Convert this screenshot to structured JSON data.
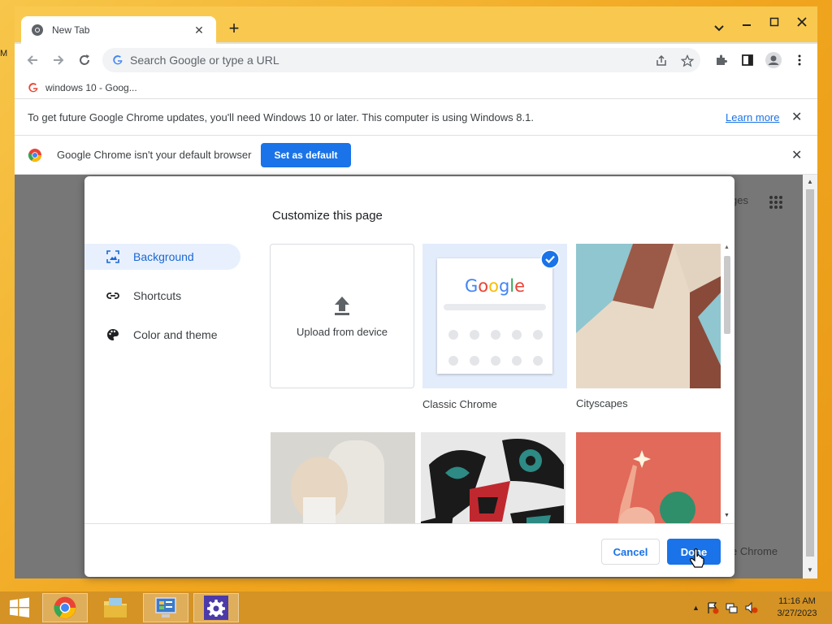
{
  "desktop": {
    "left_text": "M"
  },
  "browser": {
    "tab": {
      "title": "New Tab"
    },
    "omnibox": {
      "placeholder": "Search Google or type a URL"
    },
    "bookmark": {
      "label": "windows 10 - Goog..."
    },
    "infobar_update": {
      "message": "To get future Google Chrome updates, you'll need Windows 10 or later. This computer is using Windows 8.1.",
      "link": "Learn more"
    },
    "infobar_default": {
      "message": "Google Chrome isn't your default browser",
      "button": "Set as default"
    },
    "ntp": {
      "partial_text": "ges",
      "customize_partial": "e Chrome"
    }
  },
  "dialog": {
    "title": "Customize this page",
    "nav": [
      {
        "label": "Background",
        "icon": "image-icon",
        "active": true
      },
      {
        "label": "Shortcuts",
        "icon": "link-icon",
        "active": false
      },
      {
        "label": "Color and theme",
        "icon": "palette-icon",
        "active": false
      }
    ],
    "tiles": {
      "upload": "Upload from device",
      "classic": "Classic Chrome",
      "cityscapes": "Cityscapes"
    },
    "classic_logo": "Google",
    "cancel": "Cancel",
    "done": "Done"
  },
  "taskbar": {
    "time": "11:16 AM",
    "date": "3/27/2023"
  },
  "colors": {
    "accent": "#1a73e8",
    "active_nav_bg": "#e8f0fe",
    "frame": "#f9c94f"
  }
}
